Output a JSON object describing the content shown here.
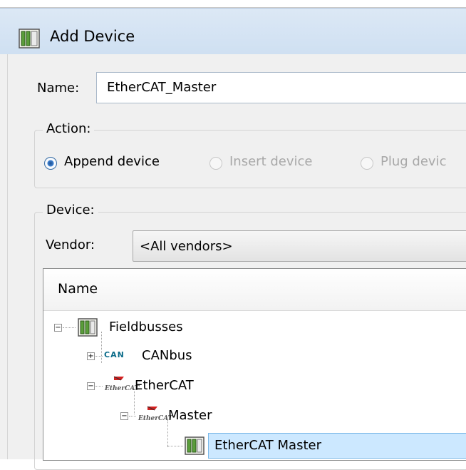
{
  "dialog": {
    "title": "Add Device",
    "title_icon": "device-icon"
  },
  "name_field": {
    "label": "Name:",
    "value": "EtherCAT_Master"
  },
  "action": {
    "group_label": "Action:",
    "options": [
      {
        "label": "Append device",
        "selected": true,
        "enabled": true
      },
      {
        "label": "Insert device",
        "selected": false,
        "enabled": false
      },
      {
        "label": "Plug devic",
        "selected": false,
        "enabled": false
      }
    ]
  },
  "device": {
    "group_label": "Device:",
    "vendor_label": "Vendor:",
    "vendor_value": "<All vendors>"
  },
  "tree": {
    "column_header": "Name",
    "nodes": [
      {
        "label": "Fieldbusses",
        "icon": "fieldbus-icon",
        "expander": "minus"
      },
      {
        "label": "CANbus",
        "icon": "can-logo-icon",
        "icon_text": "CAN",
        "expander": "plus"
      },
      {
        "label": "EtherCAT",
        "icon": "ethercat-logo-icon",
        "icon_text": "EtherCAT",
        "expander": "minus"
      },
      {
        "label": "Master",
        "icon": "ethercat-logo-icon",
        "icon_text": "EtherCAT",
        "expander": "minus"
      },
      {
        "label": "EtherCAT Master",
        "icon": "device-icon",
        "selected": true
      }
    ]
  },
  "colors": {
    "titlebar": "#d5e4f4",
    "selection": "#cce8ff",
    "can_logo": "#0c6c8a",
    "ethercat_red": "#d32020"
  }
}
